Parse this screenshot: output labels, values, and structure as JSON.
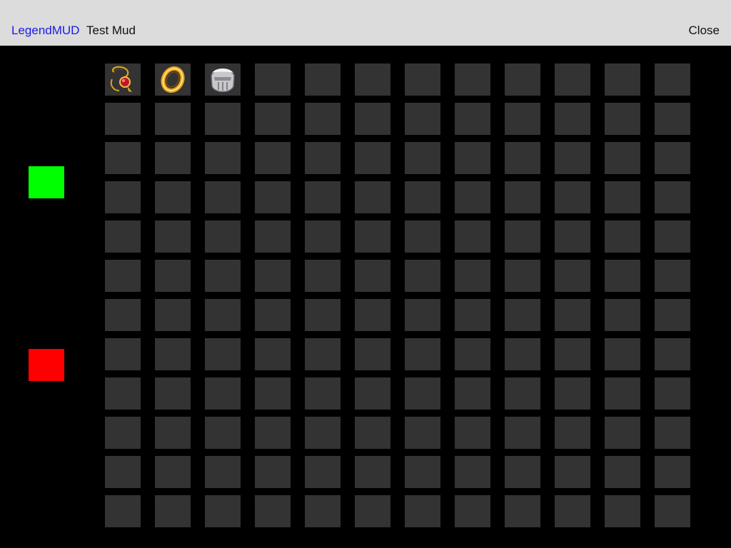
{
  "header": {
    "app_link": "LegendMUD",
    "mud_name": "Test Mud",
    "close_label": "Close"
  },
  "indicators": {
    "top_color": "#00ff00",
    "bottom_color": "#ff0000"
  },
  "inventory": {
    "columns": 12,
    "rows": 12,
    "items": [
      {
        "icon": "amulet-icon"
      },
      {
        "icon": "ring-icon"
      },
      {
        "icon": "helmet-icon"
      }
    ]
  }
}
